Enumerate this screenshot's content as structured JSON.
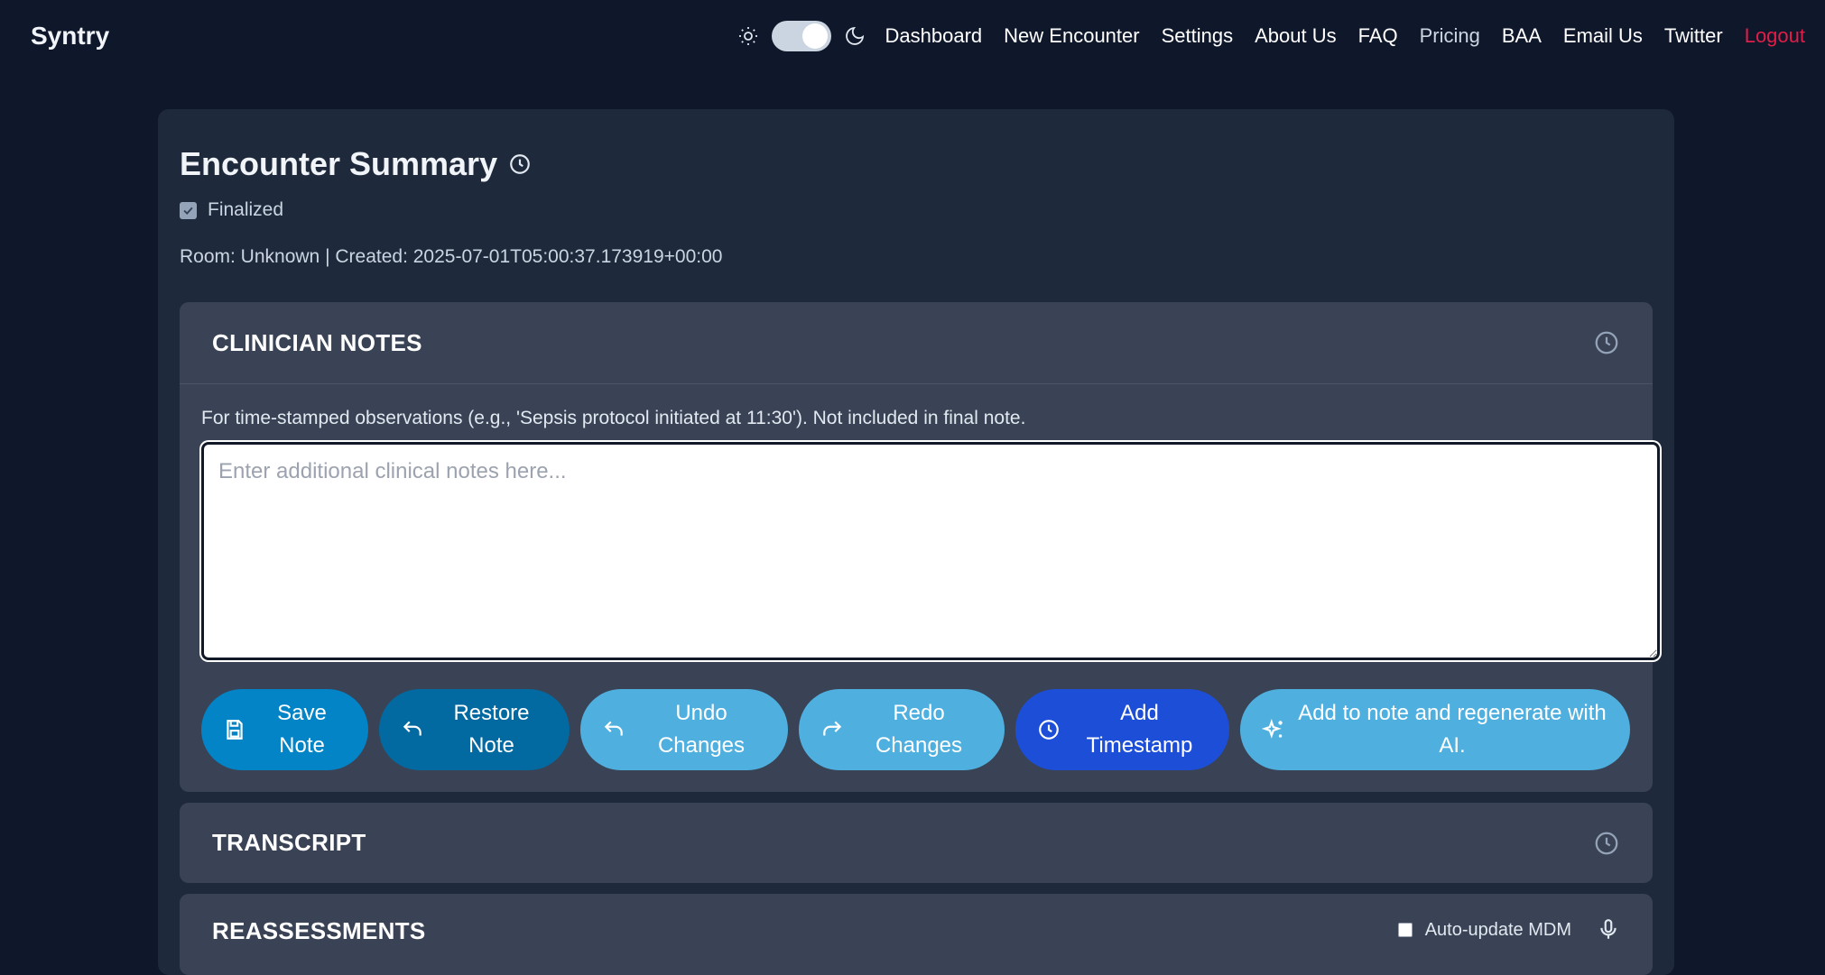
{
  "nav": {
    "brand": "Syntry",
    "links": [
      {
        "label": "Dashboard"
      },
      {
        "label": "New Encounter"
      },
      {
        "label": "Settings"
      },
      {
        "label": "About Us"
      },
      {
        "label": "FAQ"
      },
      {
        "label": "Pricing"
      },
      {
        "label": "BAA"
      },
      {
        "label": "Email Us"
      },
      {
        "label": "Twitter"
      },
      {
        "label": "Logout"
      }
    ],
    "theme_toggle": {
      "state": "dark",
      "icons": [
        "sun-icon",
        "moon-icon"
      ]
    }
  },
  "encounter": {
    "title": "Encounter Summary",
    "finalized_label": "Finalized",
    "finalized_checked": true,
    "meta": "Room: Unknown | Created: 2025-07-01T05:00:37.173919+00:00"
  },
  "clinician_notes": {
    "title": "CLINICIAN NOTES",
    "hint": "For time-stamped observations (e.g., 'Sepsis protocol initiated at 11:30'). Not included in final note.",
    "placeholder": "Enter additional clinical notes here...",
    "value": "",
    "buttons": {
      "save": "Save Note",
      "restore": "Restore Note",
      "undo": "Undo Changes",
      "redo": "Redo Changes",
      "timestamp": "Add Timestamp",
      "ai": "Add to note and regenerate with AI."
    }
  },
  "transcript": {
    "title": "TRANSCRIPT"
  },
  "reassessments": {
    "title": "REASSESSMENTS",
    "auto_update_label": "Auto-update MDM",
    "auto_update_checked": false
  },
  "colors": {
    "background": "#0f172a",
    "card": "#1e293b",
    "section": "#394355",
    "logout": "#e11d48",
    "save_button": "#0284c7",
    "restore_button": "#0369a1",
    "light_button": "#4fb0e0",
    "timestamp_button": "#1d4ed8"
  }
}
